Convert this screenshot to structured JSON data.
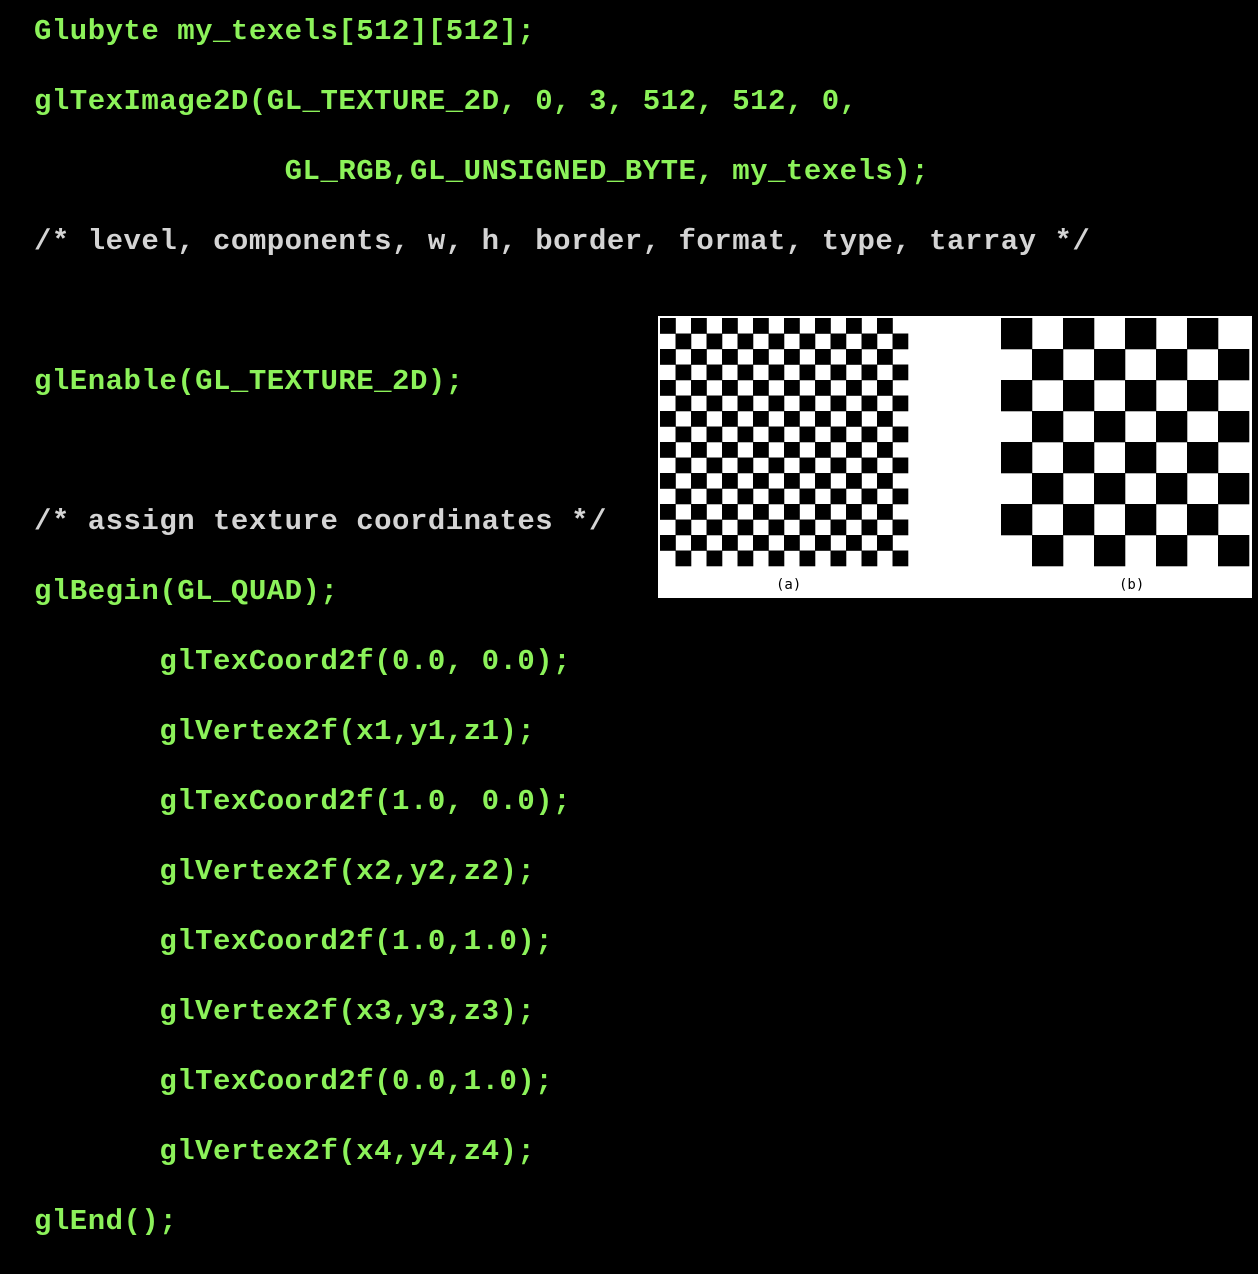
{
  "code": {
    "lines": [
      {
        "text": "Glubyte my_texels[512][512];",
        "color": "#8cf25a"
      },
      {
        "text": "glTexImage2D(GL_TEXTURE_2D, 0, 3, 512, 512, 0,",
        "color": "#8cf25a"
      },
      {
        "text": "              GL_RGB,GL_UNSIGNED_BYTE, my_texels);",
        "color": "#8cf25a"
      },
      {
        "text": "/* level, components, w, h, border, format, type, tarray */",
        "color": "#d4d4d4"
      },
      {
        "text": "",
        "color": "#8cf25a"
      },
      {
        "text": "glEnable(GL_TEXTURE_2D);",
        "color": "#8cf25a"
      },
      {
        "text": "",
        "color": "#8cf25a"
      },
      {
        "text": "/* assign texture coordinates */",
        "color": "#d4d4d4"
      },
      {
        "text": "glBegin(GL_QUAD);",
        "color": "#8cf25a"
      },
      {
        "text": "       glTexCoord2f(0.0, 0.0);",
        "color": "#8cf25a"
      },
      {
        "text": "       glVertex2f(x1,y1,z1);",
        "color": "#8cf25a"
      },
      {
        "text": "       glTexCoord2f(1.0, 0.0);",
        "color": "#8cf25a"
      },
      {
        "text": "       glVertex2f(x2,y2,z2);",
        "color": "#8cf25a"
      },
      {
        "text": "       glTexCoord2f(1.0,1.0);",
        "color": "#8cf25a"
      },
      {
        "text": "       glVertex2f(x3,y3,z3);",
        "color": "#8cf25a"
      },
      {
        "text": "       glTexCoord2f(0.0,1.0);",
        "color": "#8cf25a"
      },
      {
        "text": "       glVertex2f(x4,y4,z4);",
        "color": "#8cf25a"
      },
      {
        "text": "glEnd();",
        "color": "#8cf25a"
      }
    ]
  },
  "figure": {
    "panel_a": {
      "caption": "(a)",
      "rows": 16,
      "cols": 16
    },
    "panel_b": {
      "caption": "(b)",
      "rows": 8,
      "cols": 8
    }
  },
  "colors": {
    "background": "#000000",
    "code_green": "#8cf25a",
    "comment_gray": "#d4d4d4",
    "figure_bg": "#ffffff",
    "checker_dark": "#000000"
  }
}
